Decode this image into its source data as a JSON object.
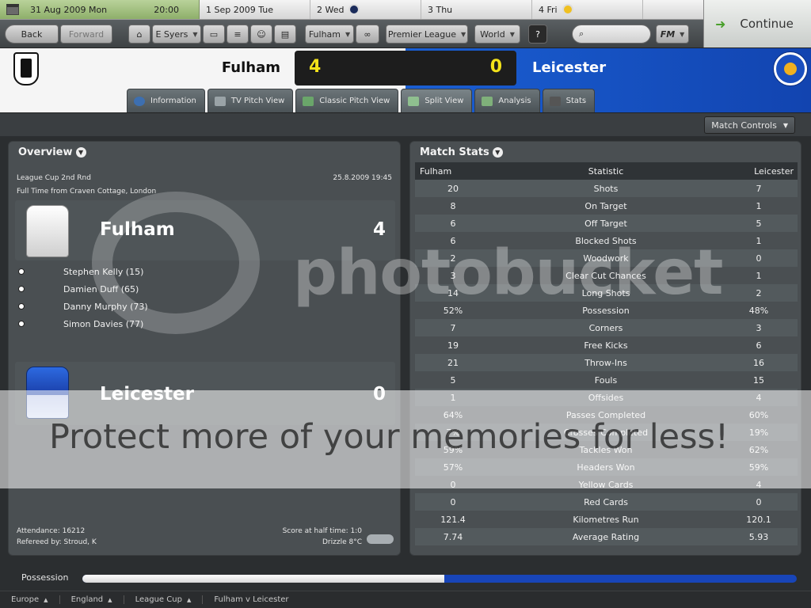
{
  "datebar": {
    "current_date": "31 Aug 2009 Mon",
    "current_time": "20:00",
    "days": [
      {
        "label": "1 Sep 2009  Tue",
        "icon": ""
      },
      {
        "label": "2  Wed",
        "icon": "club-badge-icon"
      },
      {
        "label": "3  Thu",
        "icon": ""
      },
      {
        "label": "4  Fri",
        "icon": "club-badge-icon"
      }
    ]
  },
  "toolbar": {
    "back": "Back",
    "forward": "Forward",
    "manager": "E Syers",
    "club": "Fulham",
    "league": "Premier League",
    "world": "World",
    "help": "?",
    "search_placeholder": "",
    "fm": "FM",
    "continue": "Continue"
  },
  "match": {
    "home_team": "Fulham",
    "away_team": "Leicester",
    "home_score": "4",
    "away_score": "0"
  },
  "tabs": [
    "Information",
    "TV Pitch View",
    "Classic Pitch View",
    "Split View",
    "Analysis",
    "Stats"
  ],
  "active_tab": "Split View",
  "match_controls": "Match Controls",
  "overview": {
    "title": "Overview",
    "competition": "League Cup 2nd Rnd",
    "datetime": "25.8.2009 19:45",
    "venue": "Full Time from Craven Cottage, London",
    "home_team": "Fulham",
    "home_score": "4",
    "away_team": "Leicester",
    "away_score": "0",
    "scorers": [
      "Stephen Kelly (15)",
      "Damien Duff (65)",
      "Danny Murphy (73)",
      "Simon Davies (77)"
    ],
    "attendance": "Attendance: 16212",
    "referee": "Refereed by: Stroud, K",
    "halftime": "Score at half time: 1:0",
    "weather": "Drizzle 8°C"
  },
  "stats": {
    "title": "Match Stats",
    "header": {
      "home": "Fulham",
      "stat": "Statistic",
      "away": "Leicester"
    },
    "rows": [
      {
        "home": "20",
        "stat": "Shots",
        "away": "7"
      },
      {
        "home": "8",
        "stat": "On Target",
        "away": "1"
      },
      {
        "home": "6",
        "stat": "Off Target",
        "away": "5"
      },
      {
        "home": "6",
        "stat": "Blocked Shots",
        "away": "1"
      },
      {
        "home": "2",
        "stat": "Woodwork",
        "away": "0"
      },
      {
        "home": "3",
        "stat": "Clear Cut Chances",
        "away": "1"
      },
      {
        "home": "14",
        "stat": "Long Shots",
        "away": "2"
      },
      {
        "home": "52%",
        "stat": "Possession",
        "away": "48%"
      },
      {
        "home": "7",
        "stat": "Corners",
        "away": "3"
      },
      {
        "home": "19",
        "stat": "Free Kicks",
        "away": "6"
      },
      {
        "home": "21",
        "stat": "Throw-Ins",
        "away": "16"
      },
      {
        "home": "5",
        "stat": "Fouls",
        "away": "15"
      },
      {
        "home": "1",
        "stat": "Offsides",
        "away": "4"
      },
      {
        "home": "64%",
        "stat": "Passes Completed",
        "away": "60%"
      },
      {
        "home": "7%",
        "stat": "Crosses Completed",
        "away": "19%"
      },
      {
        "home": "59%",
        "stat": "Tackles Won",
        "away": "62%"
      },
      {
        "home": "57%",
        "stat": "Headers Won",
        "away": "59%"
      },
      {
        "home": "0",
        "stat": "Yellow Cards",
        "away": "4"
      },
      {
        "home": "0",
        "stat": "Red Cards",
        "away": "0"
      },
      {
        "home": "121.4",
        "stat": "Kilometres Run",
        "away": "120.1"
      },
      {
        "home": "7.74",
        "stat": "Average Rating",
        "away": "5.93"
      }
    ]
  },
  "possession": {
    "label": "Possession",
    "home_fraction": 0.507
  },
  "breadcrumbs": [
    "Europe",
    "England",
    "League Cup",
    "Fulham v Leicester"
  ],
  "watermark": {
    "logo": "photobucket",
    "tagline": "Protect more of your memories for less!"
  },
  "colors": {
    "home_bg": "#f5f5f5",
    "away_bg": "#1a5fd3",
    "score": "#f3e21a",
    "possession_away": "#1845b8"
  }
}
